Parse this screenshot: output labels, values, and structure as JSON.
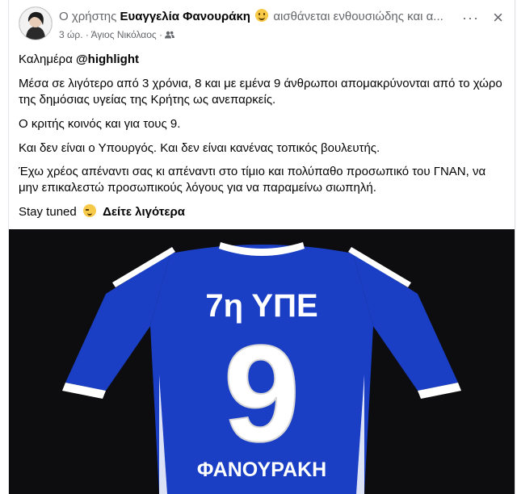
{
  "post": {
    "author_prefix": "Ο χρήστης",
    "author_name": "Ευαγγελία Φανουράκη",
    "feeling_text": "αισθάνεται ενθουσιώδης και α...",
    "time": "3 ώρ.",
    "separator": "·",
    "location": "Άγιος Νικόλαος",
    "more_label": "···",
    "close_label": "×"
  },
  "content": {
    "greeting": "Καλημέρα",
    "mention": "@highlight",
    "paragraph_2": "Μέσα σε λιγότερο από 3 χρόνια, 8 και με εμένα 9 άνθρωποι απομακρύνονται από το χώρο της δημόσιας υγείας της Κρήτης ως ανεπαρκείς.",
    "paragraph_3": "Ο κριτής κοινός και για τους 9.",
    "paragraph_4": "Και δεν είναι ο Υπουργός. Και δεν είναι κανένας τοπικός βουλευτής.",
    "paragraph_5": "Έχω χρέος απέναντι σας κι απέναντι στο τίμιο και πολύπαθο προσωπικό του ΓΝΑΝ, να μην επικαλεστώ προσωπικούς λόγους για να παραμείνω σιωπηλή.",
    "stay_tuned": "Stay tuned",
    "see_more": "Δείτε λιγότερα"
  },
  "image": {
    "shirt_title": "7η ΥΠΕ",
    "shirt_number": "9",
    "shirt_name": "ΦΑΝΟΥΡΑΚΗ",
    "shirt_color": "#1a3fc4",
    "trim_color": "#ffffff",
    "background": "#0d0d0f"
  },
  "icons": {
    "audience": "friends-icon",
    "feeling": "smiling-face-icon",
    "wink": "winking-face-icon"
  }
}
